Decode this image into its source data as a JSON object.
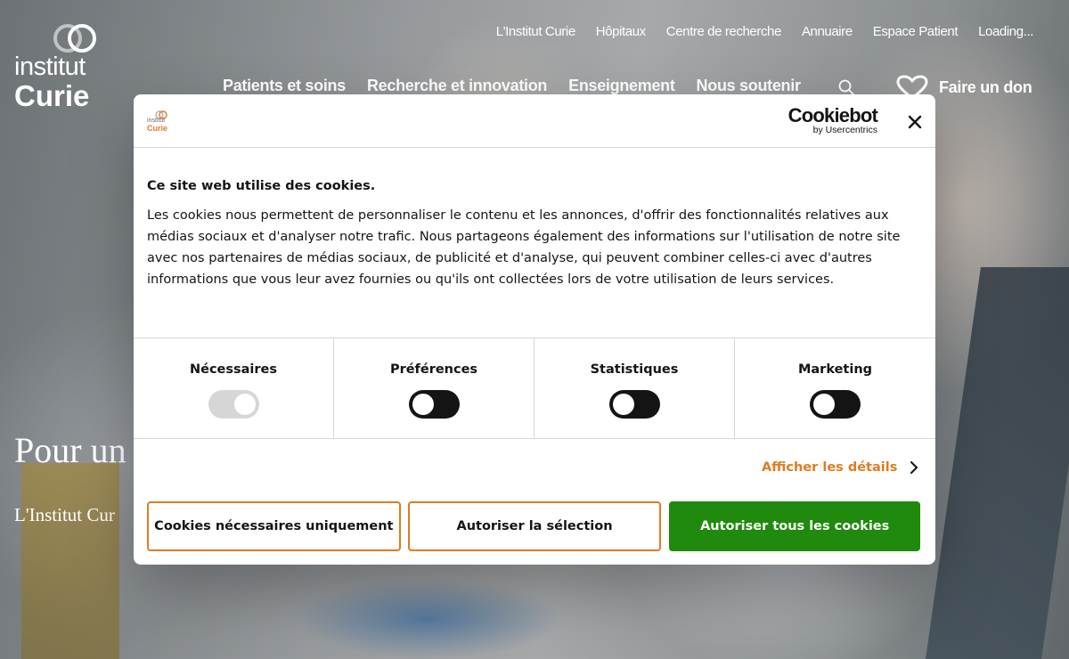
{
  "site": {
    "logo": {
      "line1": "institut",
      "line2": "Curie"
    },
    "top_links": [
      "L'Institut Curie",
      "Hôpitaux",
      "Centre de recherche",
      "Annuaire",
      "Espace Patient",
      "Loading..."
    ],
    "main_nav": [
      "Patients et soins",
      "Recherche et innovation",
      "Enseignement",
      "Nous soutenir"
    ],
    "donate_label": "Faire un don",
    "hero": {
      "title": "Pour un",
      "subtitle": "L'Institut Cur"
    }
  },
  "cookie_dialog": {
    "brand": {
      "line1": "institut",
      "line2": "Curie"
    },
    "cookiebot": {
      "main": "Cookiebot",
      "sub": "by Usercentrics"
    },
    "title": "Ce site web utilise des cookies.",
    "text": "Les cookies nous permettent de personnaliser le contenu et les annonces, d'offrir des fonctionnalités relatives aux médias sociaux et d'analyser notre trafic. Nous partageons également des informations sur l'utilisation de notre site avec nos partenaires de médias sociaux, de publicité et d'analyse, qui peuvent combiner celles-ci avec d'autres informations que vous leur avez fournies ou qu'ils ont collectées lors de votre utilisation de leurs services.",
    "categories": [
      {
        "label": "Nécessaires",
        "enabled": true,
        "locked": true
      },
      {
        "label": "Préférences",
        "enabled": false,
        "locked": false
      },
      {
        "label": "Statistiques",
        "enabled": false,
        "locked": false
      },
      {
        "label": "Marketing",
        "enabled": false,
        "locked": false
      }
    ],
    "details_label": "Afficher les détails",
    "buttons": {
      "necessary_only": "Cookies nécessaires uniquement",
      "allow_selection": "Autoriser la sélection",
      "allow_all": "Autoriser tous les cookies"
    },
    "colors": {
      "accent": "#e07b20",
      "primary": "#1f8a0d",
      "text": "#141414"
    }
  }
}
